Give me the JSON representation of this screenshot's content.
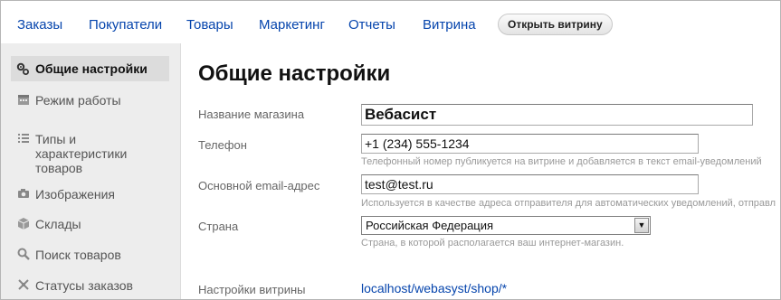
{
  "topnav": {
    "items": [
      "Заказы",
      "Покупатели",
      "Товары",
      "Маркетинг",
      "Отчеты",
      "Витрина"
    ],
    "open_storefront": "Открыть витрину"
  },
  "sidebar": {
    "items": [
      {
        "label": "Общие настройки",
        "icon": "gears-icon",
        "active": true
      },
      {
        "label": "Режим работы",
        "icon": "calendar-icon"
      },
      {
        "label": "Типы и характеристики товаров",
        "icon": "list-icon"
      },
      {
        "label": "Изображения",
        "icon": "camera-icon"
      },
      {
        "label": "Склады",
        "icon": "boxes-icon"
      },
      {
        "label": "Поиск товаров",
        "icon": "search-icon"
      },
      {
        "label": "Статусы заказов",
        "icon": "workflow-icon"
      }
    ]
  },
  "main": {
    "title": "Общие настройки",
    "store_name": {
      "label": "Название магазина",
      "value": "Вебасист"
    },
    "phone": {
      "label": "Телефон",
      "value": "+1 (234) 555-1234",
      "hint": "Телефонный номер публикуется на витрине и добавляется в текст email-уведомлений"
    },
    "email": {
      "label": "Основной email-адрес",
      "value": "test@test.ru",
      "hint": "Используется в качестве адреса отправителя для автоматических уведомлений, отправл"
    },
    "country": {
      "label": "Страна",
      "value": "Российская Федерация",
      "hint": "Страна, в которой располагается ваш интернет-магазин."
    },
    "storefront": {
      "label": "Настройки витрины",
      "link": "localhost/webasyst/shop/*"
    }
  }
}
